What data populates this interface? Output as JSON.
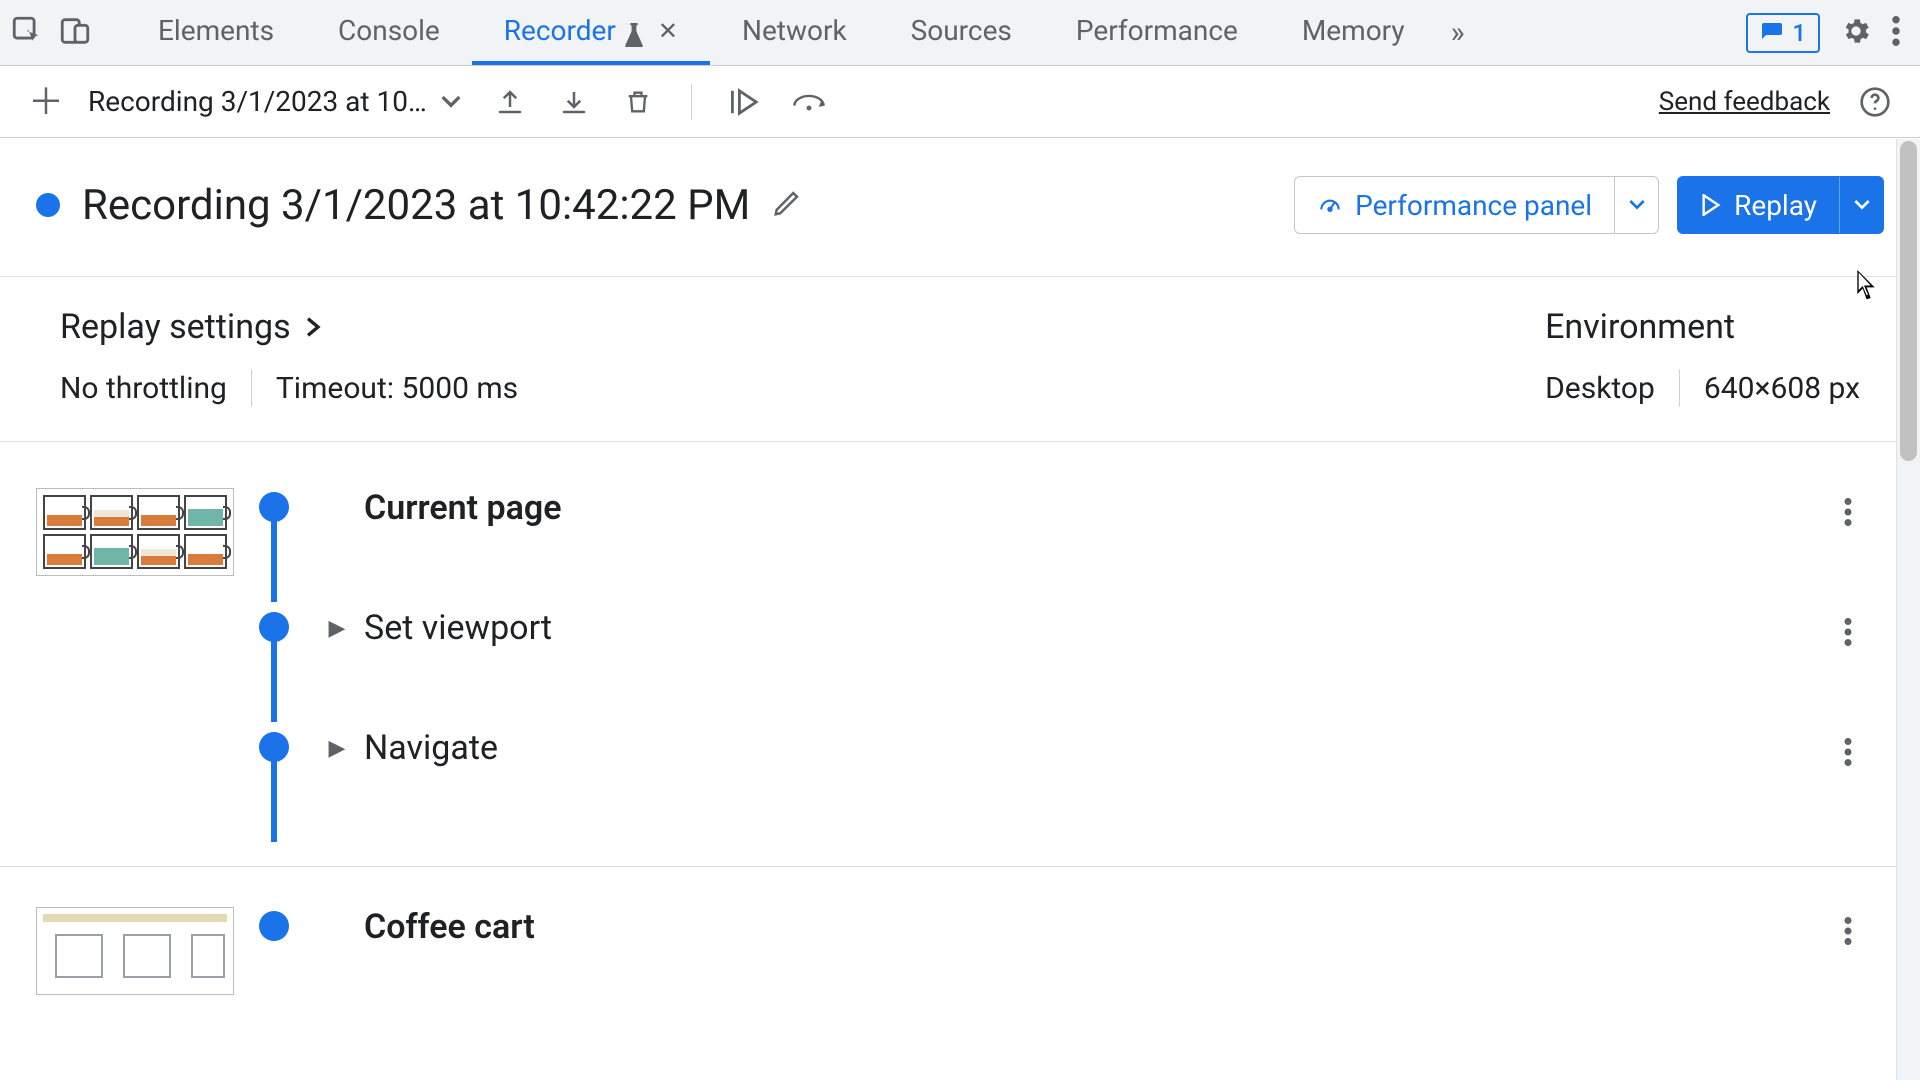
{
  "tabs": {
    "elements": "Elements",
    "console": "Console",
    "recorder": "Recorder",
    "network": "Network",
    "sources": "Sources",
    "performance": "Performance",
    "memory": "Memory"
  },
  "issues_count": "1",
  "toolbar": {
    "recording_short": "Recording 3/1/2023 at 10…",
    "feedback": "Send feedback"
  },
  "recording": {
    "title": "Recording 3/1/2023 at 10:42:22 PM",
    "perf_panel": "Performance panel",
    "replay": "Replay"
  },
  "settings": {
    "replay_heading": "Replay settings",
    "throttling": "No throttling",
    "timeout": "Timeout: 5000 ms",
    "env_heading": "Environment",
    "device": "Desktop",
    "viewport": "640×608 px"
  },
  "steps": {
    "s1": "Current page",
    "s2": "Set viewport",
    "s3": "Navigate",
    "s4": "Coffee cart"
  }
}
